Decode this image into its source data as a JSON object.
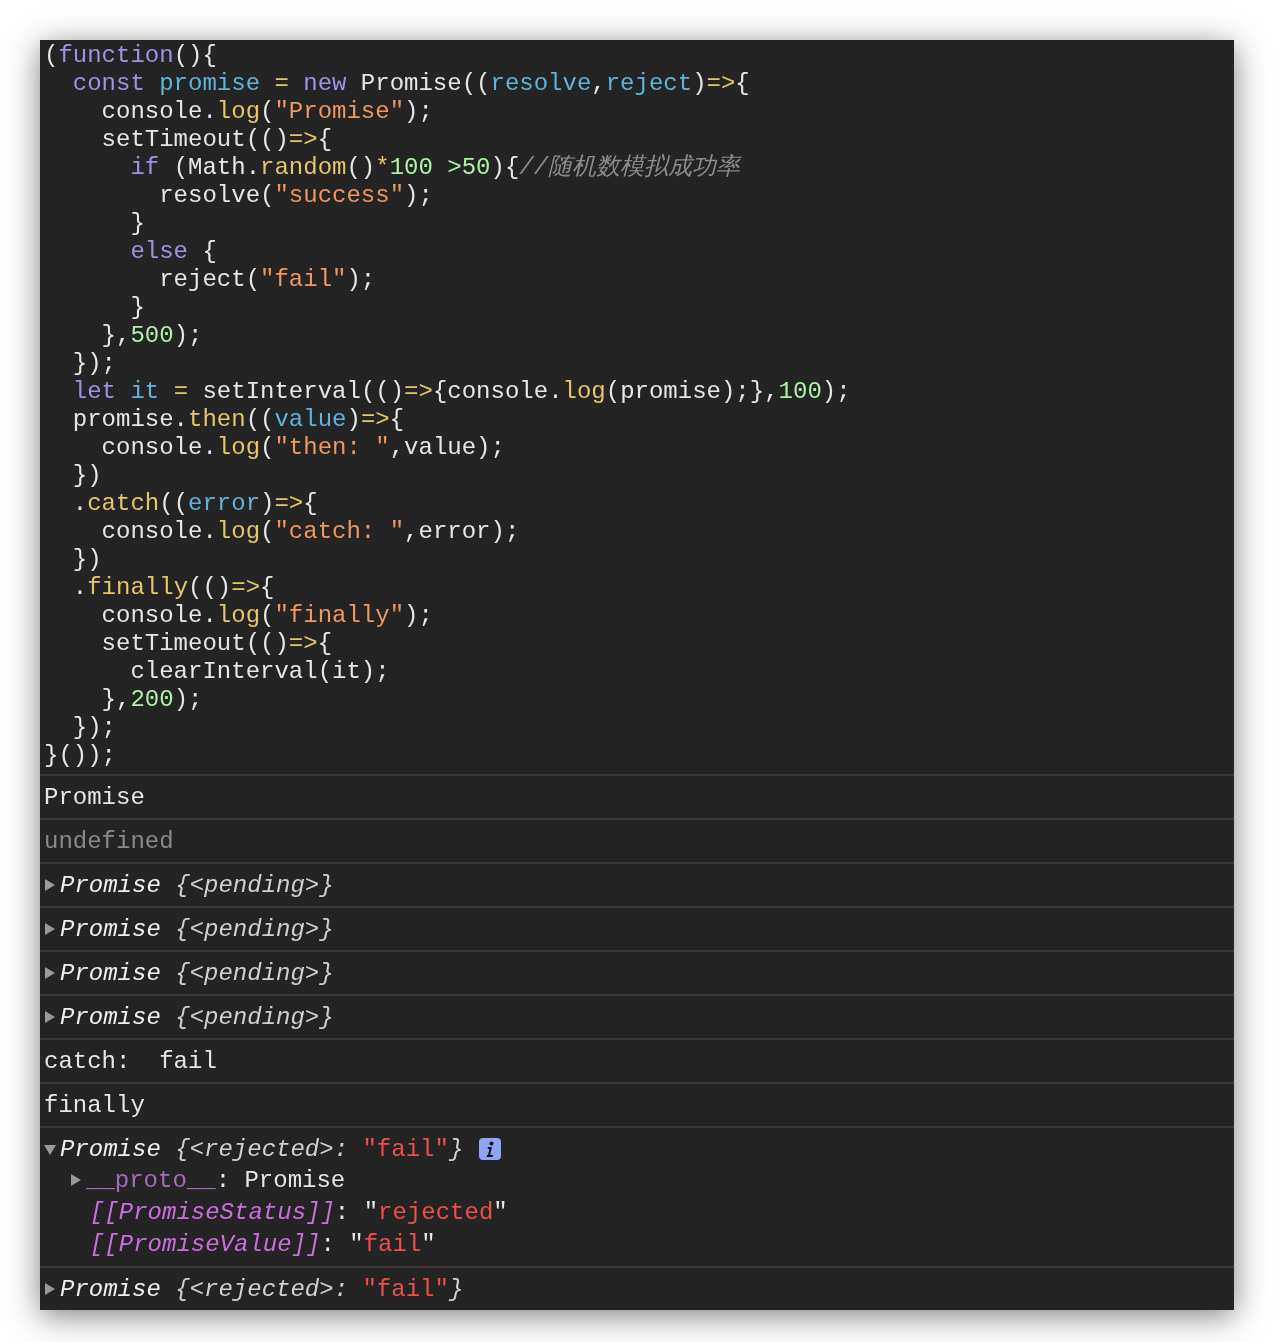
{
  "code": [
    [
      {
        "kind": "p",
        "text": "("
      },
      {
        "kind": "kw",
        "text": "function"
      },
      {
        "kind": "p",
        "text": "(){"
      }
    ],
    [
      {
        "kind": "kw",
        "text": "  const "
      },
      {
        "kind": "var",
        "text": "promise "
      },
      {
        "kind": "fn",
        "text": "= "
      },
      {
        "kind": "kw",
        "text": "new "
      },
      {
        "kind": "p",
        "text": "Promise(("
      },
      {
        "kind": "var",
        "text": "resolve"
      },
      {
        "kind": "p",
        "text": ","
      },
      {
        "kind": "var",
        "text": "reject"
      },
      {
        "kind": "p",
        "text": ")"
      },
      {
        "kind": "fn",
        "text": "=>"
      },
      {
        "kind": "p",
        "text": "{"
      }
    ],
    [
      {
        "kind": "p",
        "text": "    console."
      },
      {
        "kind": "fn",
        "text": "log"
      },
      {
        "kind": "p",
        "text": "("
      },
      {
        "kind": "str",
        "text": "\"Promise\""
      },
      {
        "kind": "p",
        "text": ");"
      }
    ],
    [
      {
        "kind": "p",
        "text": "    setTimeout(()"
      },
      {
        "kind": "fn",
        "text": "=>"
      },
      {
        "kind": "p",
        "text": "{"
      }
    ],
    [
      {
        "kind": "kw",
        "text": "      if "
      },
      {
        "kind": "p",
        "text": "(Math."
      },
      {
        "kind": "fn",
        "text": "random"
      },
      {
        "kind": "p",
        "text": "()"
      },
      {
        "kind": "fn",
        "text": "*"
      },
      {
        "kind": "num",
        "text": "100 "
      },
      {
        "kind": "num",
        "text": ">50"
      },
      {
        "kind": "p",
        "text": "){"
      },
      {
        "kind": "cmt",
        "text": "//随机数模拟成功率"
      }
    ],
    [
      {
        "kind": "p",
        "text": "        resolve("
      },
      {
        "kind": "str",
        "text": "\"success\""
      },
      {
        "kind": "p",
        "text": ");"
      }
    ],
    [
      {
        "kind": "p",
        "text": "      }"
      }
    ],
    [
      {
        "kind": "kw",
        "text": "      else"
      },
      {
        "kind": "p",
        "text": " {"
      }
    ],
    [
      {
        "kind": "p",
        "text": "        reject("
      },
      {
        "kind": "str",
        "text": "\"fail\""
      },
      {
        "kind": "p",
        "text": ");"
      }
    ],
    [
      {
        "kind": "p",
        "text": "      }"
      }
    ],
    [
      {
        "kind": "p",
        "text": "    },"
      },
      {
        "kind": "num",
        "text": "500"
      },
      {
        "kind": "p",
        "text": ");"
      }
    ],
    [
      {
        "kind": "p",
        "text": "  });"
      }
    ],
    [
      {
        "kind": "kw",
        "text": "  let "
      },
      {
        "kind": "var",
        "text": "it "
      },
      {
        "kind": "fn",
        "text": "= "
      },
      {
        "kind": "p",
        "text": "setInterval(()"
      },
      {
        "kind": "fn",
        "text": "=>"
      },
      {
        "kind": "p",
        "text": "{console."
      },
      {
        "kind": "fn",
        "text": "log"
      },
      {
        "kind": "p",
        "text": "(promise);},"
      },
      {
        "kind": "num",
        "text": "100"
      },
      {
        "kind": "p",
        "text": ");"
      }
    ],
    [
      {
        "kind": "p",
        "text": "  promise."
      },
      {
        "kind": "fn",
        "text": "then"
      },
      {
        "kind": "p",
        "text": "(("
      },
      {
        "kind": "var",
        "text": "value"
      },
      {
        "kind": "p",
        "text": ")"
      },
      {
        "kind": "fn",
        "text": "=>"
      },
      {
        "kind": "p",
        "text": "{"
      }
    ],
    [
      {
        "kind": "p",
        "text": "    console."
      },
      {
        "kind": "fn",
        "text": "log"
      },
      {
        "kind": "p",
        "text": "("
      },
      {
        "kind": "str",
        "text": "\"then: \""
      },
      {
        "kind": "p",
        "text": ",value);"
      }
    ],
    [
      {
        "kind": "p",
        "text": "  })"
      }
    ],
    [
      {
        "kind": "p",
        "text": "  ."
      },
      {
        "kind": "fn",
        "text": "catch"
      },
      {
        "kind": "p",
        "text": "(("
      },
      {
        "kind": "var",
        "text": "error"
      },
      {
        "kind": "p",
        "text": ")"
      },
      {
        "kind": "fn",
        "text": "=>"
      },
      {
        "kind": "p",
        "text": "{"
      }
    ],
    [
      {
        "kind": "p",
        "text": "    console."
      },
      {
        "kind": "fn",
        "text": "log"
      },
      {
        "kind": "p",
        "text": "("
      },
      {
        "kind": "str",
        "text": "\"catch: \""
      },
      {
        "kind": "p",
        "text": ",error);"
      }
    ],
    [
      {
        "kind": "p",
        "text": "  })"
      }
    ],
    [
      {
        "kind": "p",
        "text": "  ."
      },
      {
        "kind": "fn",
        "text": "finally"
      },
      {
        "kind": "p",
        "text": "(()"
      },
      {
        "kind": "fn",
        "text": "=>"
      },
      {
        "kind": "p",
        "text": "{"
      }
    ],
    [
      {
        "kind": "p",
        "text": "    console."
      },
      {
        "kind": "fn",
        "text": "log"
      },
      {
        "kind": "p",
        "text": "("
      },
      {
        "kind": "str",
        "text": "\"finally\""
      },
      {
        "kind": "p",
        "text": ");"
      }
    ],
    [
      {
        "kind": "p",
        "text": "    setTimeout(()"
      },
      {
        "kind": "fn",
        "text": "=>"
      },
      {
        "kind": "p",
        "text": "{"
      }
    ],
    [
      {
        "kind": "p",
        "text": "      clearInterval(it);"
      }
    ],
    [
      {
        "kind": "p",
        "text": "    },"
      },
      {
        "kind": "num",
        "text": "200"
      },
      {
        "kind": "p",
        "text": ");"
      }
    ],
    [
      {
        "kind": "p",
        "text": "  });"
      }
    ],
    [
      {
        "kind": "p",
        "text": "}());"
      }
    ]
  ],
  "console": [
    {
      "kind": "text",
      "tokens": [
        {
          "kind": "p",
          "text": "Promise"
        }
      ]
    },
    {
      "kind": "muted",
      "tokens": [
        {
          "kind": "p",
          "text": "undefined"
        }
      ]
    },
    {
      "kind": "object",
      "expanded": false,
      "tokens": [
        {
          "kind": "name",
          "text": "Promise"
        },
        {
          "kind": "state",
          "text": " {<pending>}"
        }
      ]
    },
    {
      "kind": "object",
      "expanded": false,
      "tokens": [
        {
          "kind": "name",
          "text": "Promise"
        },
        {
          "kind": "state",
          "text": " {<pending>}"
        }
      ]
    },
    {
      "kind": "object",
      "expanded": false,
      "tokens": [
        {
          "kind": "name",
          "text": "Promise"
        },
        {
          "kind": "state",
          "text": " {<pending>}"
        }
      ]
    },
    {
      "kind": "object",
      "expanded": false,
      "tokens": [
        {
          "kind": "name",
          "text": "Promise"
        },
        {
          "kind": "state",
          "text": " {<pending>}"
        }
      ]
    },
    {
      "kind": "text",
      "tokens": [
        {
          "kind": "p",
          "text": "catch:  fail"
        }
      ]
    },
    {
      "kind": "text",
      "tokens": [
        {
          "kind": "p",
          "text": "finally"
        }
      ]
    },
    {
      "kind": "object",
      "expanded": true,
      "info": true,
      "tokens": [
        {
          "kind": "name",
          "text": "Promise"
        },
        {
          "kind": "state",
          "text": " {<rejected>: "
        },
        {
          "kind": "err",
          "text": "\"fail\""
        },
        {
          "kind": "state",
          "text": "}"
        }
      ],
      "children": [
        {
          "expanded": false,
          "tokens": [
            {
              "kind": "proto",
              "text": "__proto__"
            },
            {
              "kind": "p",
              "text": ": Promise"
            }
          ]
        },
        {
          "tokens": [
            {
              "kind": "internal",
              "text": "[[PromiseStatus]]"
            },
            {
              "kind": "p",
              "text": ": \""
            },
            {
              "kind": "err",
              "text": "rejected"
            },
            {
              "kind": "p",
              "text": "\""
            }
          ]
        },
        {
          "tokens": [
            {
              "kind": "internal",
              "text": "[[PromiseValue]]"
            },
            {
              "kind": "p",
              "text": ": \""
            },
            {
              "kind": "err",
              "text": "fail"
            },
            {
              "kind": "p",
              "text": "\""
            }
          ]
        }
      ]
    },
    {
      "kind": "object",
      "expanded": false,
      "tokens": [
        {
          "kind": "name",
          "text": "Promise"
        },
        {
          "kind": "state",
          "text": " {<rejected>: "
        },
        {
          "kind": "err",
          "text": "\"fail\""
        },
        {
          "kind": "state",
          "text": "}"
        }
      ]
    }
  ]
}
